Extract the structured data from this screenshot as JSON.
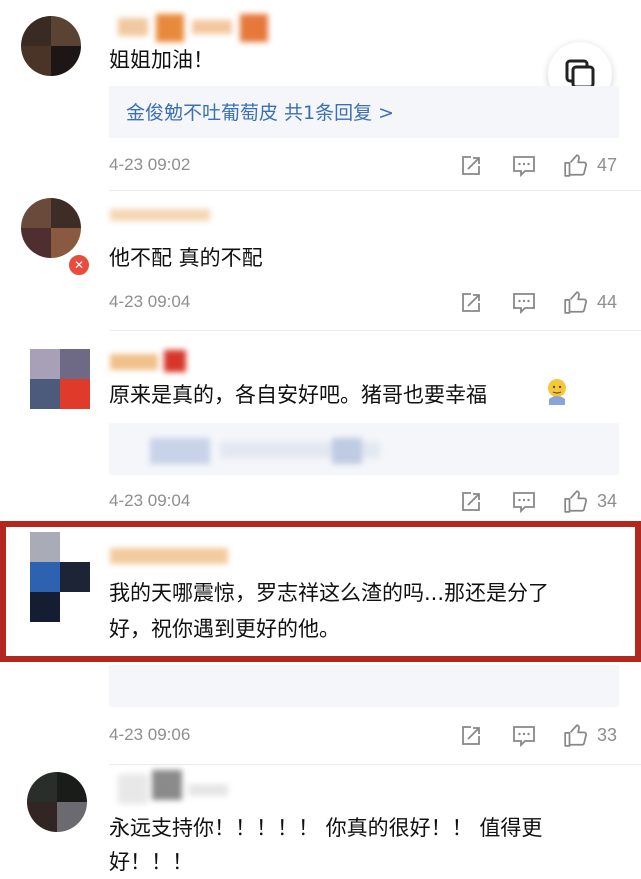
{
  "comments": [
    {
      "content": [
        "姐姐加油！"
      ],
      "reply_summary": "金俊勉不吐葡萄皮  共1条回复 >",
      "time": "4-23 09:02",
      "likes": "47"
    },
    {
      "content": [
        "他不配 真的不配"
      ],
      "time": "4-23 09:04",
      "likes": "44"
    },
    {
      "content": [
        "原来是真的，各自安好吧。猪哥也要幸福"
      ],
      "time": "4-23 09:04",
      "likes": "34"
    },
    {
      "content": [
        "我的天哪震惊，罗志祥这么渣的吗...那还是分了",
        "好，祝你遇到更好的他。"
      ],
      "time": "4-23 09:06",
      "likes": "33"
    },
    {
      "content": [
        "永远支持你！！！！！ 你真的很好！！ 值得更",
        "好！！！"
      ]
    }
  ],
  "colors": {
    "accent_link": "#3c6fb5",
    "highlight_border": "#b3281e",
    "meta_gray": "#8e8e8e",
    "username_orange": "#e6a552"
  },
  "icons": [
    "share-icon",
    "comment-icon",
    "like-icon",
    "float-copy-icon",
    "emoji-face-icon"
  ]
}
